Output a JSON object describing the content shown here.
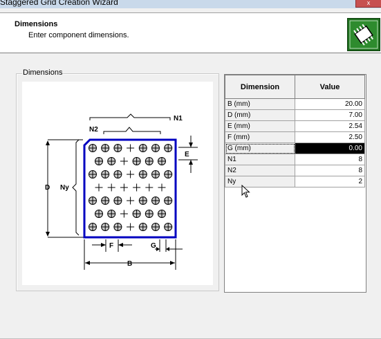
{
  "window": {
    "title": "Staggered Grid Creation Wizard",
    "close_glyph": "x"
  },
  "header": {
    "title": "Dimensions",
    "subtitle": "Enter component dimensions.",
    "logo_icon": "wizard-chip-icon"
  },
  "group": {
    "label": "Dimensions"
  },
  "figure": {
    "labels": {
      "b": "B",
      "d": "D",
      "e": "E",
      "f": "F",
      "g": "G",
      "n1": "N1",
      "n2": "N2",
      "ny": "Ny"
    },
    "rows": [
      [
        "ball",
        "ball",
        "ball",
        "cross",
        "ball",
        "ball",
        "ball"
      ],
      [
        "ball",
        "ball",
        "cross",
        "ball",
        "ball",
        "ball"
      ],
      [
        "ball",
        "ball",
        "ball",
        "cross",
        "ball",
        "ball",
        "ball"
      ],
      [
        "cross",
        "cross",
        "cross",
        "cross",
        "cross",
        "cross"
      ],
      [
        "ball",
        "ball",
        "ball",
        "cross",
        "ball",
        "ball",
        "ball"
      ],
      [
        "ball",
        "ball",
        "cross",
        "ball",
        "ball",
        "ball"
      ],
      [
        "ball",
        "ball",
        "ball",
        "cross",
        "ball",
        "ball",
        "ball"
      ]
    ],
    "outline_color": "#0000c0"
  },
  "table": {
    "headers": {
      "dimension": "Dimension",
      "value": "Value"
    },
    "rows": [
      {
        "name": "B (mm)",
        "value": "20.00"
      },
      {
        "name": "D (mm)",
        "value": "7.00"
      },
      {
        "name": "E (mm)",
        "value": "2.54"
      },
      {
        "name": "F (mm)",
        "value": "2.50"
      },
      {
        "name": "G (mm)",
        "value": "0.00"
      },
      {
        "name": "N1",
        "value": "8"
      },
      {
        "name": "N2",
        "value": "8"
      },
      {
        "name": "Ny",
        "value": "2"
      }
    ],
    "selected_row": 4
  }
}
